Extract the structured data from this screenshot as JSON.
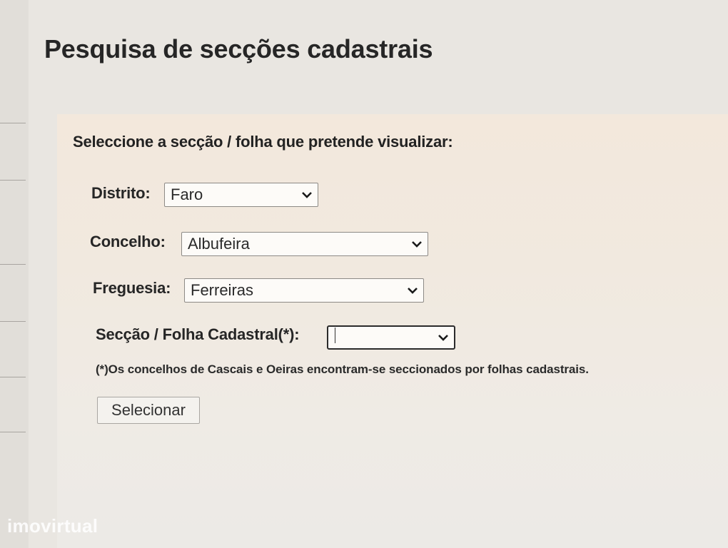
{
  "page": {
    "title": "Pesquisa de secções cadastrais"
  },
  "form": {
    "heading": "Seleccione a secção / folha que pretende visualizar:",
    "distrito": {
      "label": "Distrito:",
      "value": "Faro"
    },
    "concelho": {
      "label": "Concelho:",
      "value": "Albufeira"
    },
    "freguesia": {
      "label": "Freguesia:",
      "value": "Ferreiras"
    },
    "seccao": {
      "label": "Secção / Folha Cadastral(*):",
      "value": ""
    },
    "footnote": "(*)Os concelhos de Cascais e Oeiras encontram-se seccionados por folhas cadastrais.",
    "submit_label": "Selecionar"
  },
  "watermark": "imovirtual",
  "colors": {
    "panel_background": "#f3e8dc",
    "page_background": "#e9e6e1",
    "text": "#262626"
  },
  "icons": {
    "dropdown": "chevron-down-icon"
  }
}
